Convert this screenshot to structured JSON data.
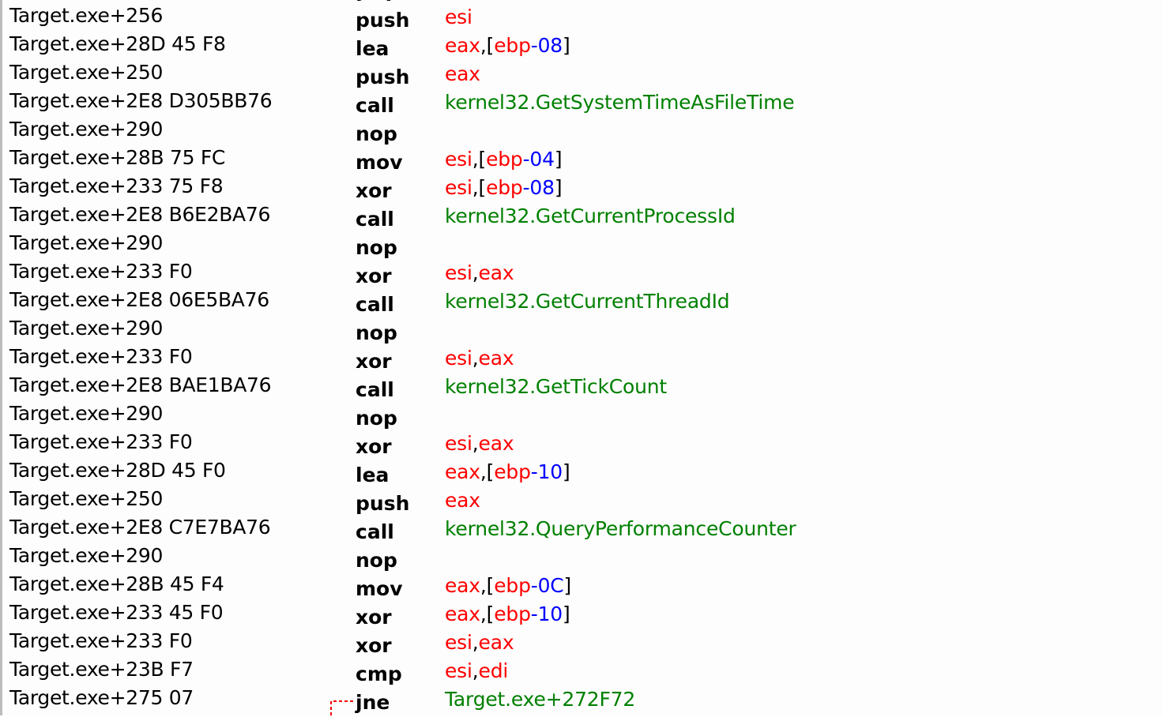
{
  "top_fragment": "jmp",
  "rows": [
    {
      "addr": "Target.exe+256",
      "opcode": "push",
      "operands": [
        {
          "t": "esi",
          "c": "op-reg"
        }
      ]
    },
    {
      "addr": "Target.exe+28D 45 F8",
      "opcode": "lea",
      "operands": [
        {
          "t": "eax",
          "c": "op-reg"
        },
        {
          "t": ",[",
          "c": "op-punct"
        },
        {
          "t": "ebp",
          "c": "op-reg"
        },
        {
          "t": "-08",
          "c": "op-num"
        },
        {
          "t": "]",
          "c": "op-punct"
        }
      ]
    },
    {
      "addr": "Target.exe+250",
      "opcode": "push",
      "operands": [
        {
          "t": "eax",
          "c": "op-reg"
        }
      ]
    },
    {
      "addr": "Target.exe+2E8 D305BB76",
      "opcode": "call",
      "operands": [
        {
          "t": "kernel32.GetSystemTimeAsFileTime",
          "c": "op-call"
        }
      ]
    },
    {
      "addr": "Target.exe+290",
      "opcode": "nop",
      "operands": []
    },
    {
      "addr": "Target.exe+28B 75 FC",
      "opcode": "mov",
      "operands": [
        {
          "t": "esi",
          "c": "op-reg"
        },
        {
          "t": ",[",
          "c": "op-punct"
        },
        {
          "t": "ebp",
          "c": "op-reg"
        },
        {
          "t": "-04",
          "c": "op-num"
        },
        {
          "t": "]",
          "c": "op-punct"
        }
      ]
    },
    {
      "addr": "Target.exe+233 75 F8",
      "opcode": "xor",
      "operands": [
        {
          "t": "esi",
          "c": "op-reg"
        },
        {
          "t": ",[",
          "c": "op-punct"
        },
        {
          "t": "ebp",
          "c": "op-reg"
        },
        {
          "t": "-08",
          "c": "op-num"
        },
        {
          "t": "]",
          "c": "op-punct"
        }
      ]
    },
    {
      "addr": "Target.exe+2E8 B6E2BA76",
      "opcode": "call",
      "operands": [
        {
          "t": "kernel32.GetCurrentProcessId",
          "c": "op-call"
        }
      ]
    },
    {
      "addr": "Target.exe+290",
      "opcode": "nop",
      "operands": []
    },
    {
      "addr": "Target.exe+233 F0",
      "opcode": "xor",
      "operands": [
        {
          "t": "esi",
          "c": "op-reg"
        },
        {
          "t": ",",
          "c": "op-punct"
        },
        {
          "t": "eax",
          "c": "op-reg"
        }
      ]
    },
    {
      "addr": "Target.exe+2E8 06E5BA76",
      "opcode": "call",
      "operands": [
        {
          "t": "kernel32.GetCurrentThreadId",
          "c": "op-call"
        }
      ]
    },
    {
      "addr": "Target.exe+290",
      "opcode": "nop",
      "operands": []
    },
    {
      "addr": "Target.exe+233 F0",
      "opcode": "xor",
      "operands": [
        {
          "t": "esi",
          "c": "op-reg"
        },
        {
          "t": ",",
          "c": "op-punct"
        },
        {
          "t": "eax",
          "c": "op-reg"
        }
      ]
    },
    {
      "addr": "Target.exe+2E8 BAE1BA76",
      "opcode": "call",
      "operands": [
        {
          "t": "kernel32.GetTickCount",
          "c": "op-call"
        }
      ]
    },
    {
      "addr": "Target.exe+290",
      "opcode": "nop",
      "operands": []
    },
    {
      "addr": "Target.exe+233 F0",
      "opcode": "xor",
      "operands": [
        {
          "t": "esi",
          "c": "op-reg"
        },
        {
          "t": ",",
          "c": "op-punct"
        },
        {
          "t": "eax",
          "c": "op-reg"
        }
      ]
    },
    {
      "addr": "Target.exe+28D 45 F0",
      "opcode": "lea",
      "operands": [
        {
          "t": "eax",
          "c": "op-reg"
        },
        {
          "t": ",[",
          "c": "op-punct"
        },
        {
          "t": "ebp",
          "c": "op-reg"
        },
        {
          "t": "-10",
          "c": "op-num"
        },
        {
          "t": "]",
          "c": "op-punct"
        }
      ]
    },
    {
      "addr": "Target.exe+250",
      "opcode": "push",
      "operands": [
        {
          "t": "eax",
          "c": "op-reg"
        }
      ]
    },
    {
      "addr": "Target.exe+2E8 C7E7BA76",
      "opcode": "call",
      "operands": [
        {
          "t": "kernel32.QueryPerformanceCounter",
          "c": "op-call"
        }
      ]
    },
    {
      "addr": "Target.exe+290",
      "opcode": "nop",
      "operands": []
    },
    {
      "addr": "Target.exe+28B 45 F4",
      "opcode": "mov",
      "operands": [
        {
          "t": "eax",
          "c": "op-reg"
        },
        {
          "t": ",[",
          "c": "op-punct"
        },
        {
          "t": "ebp",
          "c": "op-reg"
        },
        {
          "t": "-0C",
          "c": "op-num"
        },
        {
          "t": "]",
          "c": "op-punct"
        }
      ]
    },
    {
      "addr": "Target.exe+233 45 F0",
      "opcode": "xor",
      "operands": [
        {
          "t": "eax",
          "c": "op-reg"
        },
        {
          "t": ",[",
          "c": "op-punct"
        },
        {
          "t": "ebp",
          "c": "op-reg"
        },
        {
          "t": "-10",
          "c": "op-num"
        },
        {
          "t": "]",
          "c": "op-punct"
        }
      ]
    },
    {
      "addr": "Target.exe+233 F0",
      "opcode": "xor",
      "operands": [
        {
          "t": "esi",
          "c": "op-reg"
        },
        {
          "t": ",",
          "c": "op-punct"
        },
        {
          "t": "eax",
          "c": "op-reg"
        }
      ]
    },
    {
      "addr": "Target.exe+23B F7",
      "opcode": "cmp",
      "operands": [
        {
          "t": "esi",
          "c": "op-reg"
        },
        {
          "t": ",",
          "c": "op-punct"
        },
        {
          "t": "edi",
          "c": "op-reg"
        }
      ]
    },
    {
      "addr": "Target.exe+275 07",
      "opcode": "jne",
      "operands": [
        {
          "t": "Target.exe+272F72",
          "c": "op-call"
        }
      ]
    }
  ],
  "colors": {
    "register": "#ff0000",
    "number": "#0000ff",
    "call_target": "#008000",
    "text": "#000000",
    "jump_marker": "#ff0000"
  }
}
